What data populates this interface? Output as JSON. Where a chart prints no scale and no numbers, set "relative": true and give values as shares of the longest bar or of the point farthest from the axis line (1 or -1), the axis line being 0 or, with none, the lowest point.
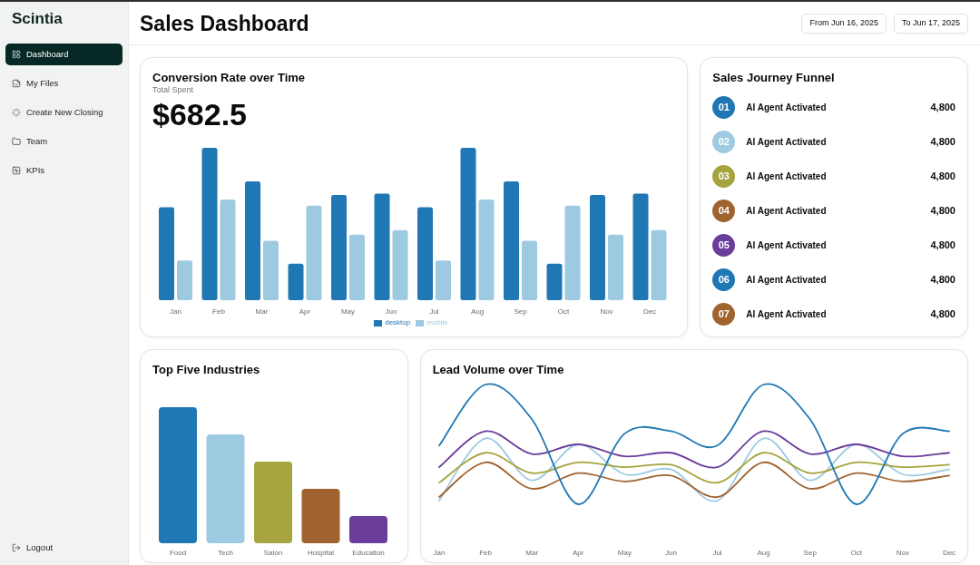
{
  "sidebar": {
    "brand": "Scintia",
    "items": [
      {
        "label": "Dashboard",
        "selected": true
      },
      {
        "label": "My Files",
        "selected": false
      },
      {
        "label": "Create New Closing",
        "selected": false
      },
      {
        "label": "Team",
        "selected": false
      },
      {
        "label": "KPIs",
        "selected": false
      }
    ],
    "footer": {
      "label": "Logout"
    }
  },
  "header": {
    "title": "Sales Dashboard",
    "date_range": [
      "From Jun 16, 2025",
      "To Jun 17, 2025"
    ]
  },
  "conversion_card": {
    "title": "Conversion Rate over Time",
    "subtitle": "Total Spent",
    "amount": "$682.5",
    "chart_data": {
      "type": "bar",
      "relative": true,
      "legend": "bottom",
      "categories": [
        "Jan",
        "Feb",
        "Mar",
        "Apr",
        "May",
        "Jun",
        "Jul",
        "Aug",
        "Sep",
        "Oct",
        "Nov",
        "Dec"
      ],
      "series": [
        {
          "name": "desktop",
          "color": "#1f77b4",
          "values": [
            0.61,
            1,
            0.78,
            0.24,
            0.69,
            0.7,
            0.61,
            1,
            0.78,
            0.24,
            0.69,
            0.7
          ]
        },
        {
          "name": "mobile",
          "color": "#9ecae1",
          "values": [
            0.26,
            0.66,
            0.39,
            0.62,
            0.43,
            0.46,
            0.26,
            0.66,
            0.39,
            0.62,
            0.43,
            0.46
          ]
        }
      ]
    }
  },
  "funnel": {
    "title": "Sales Journey Funnel",
    "items": [
      {
        "number": "01",
        "label": "AI Agent Activated",
        "value": "4,800",
        "color": "#1f77b4"
      },
      {
        "number": "02",
        "label": "AI Agent Activated",
        "value": "4,800",
        "color": "#9ecae1"
      },
      {
        "number": "03",
        "label": "AI Agent Activated",
        "value": "4,800",
        "color": "#a5a43f"
      },
      {
        "number": "04",
        "label": "AI Agent Activated",
        "value": "4,800",
        "color": "#a0632f"
      },
      {
        "number": "05",
        "label": "AI Agent Activated",
        "value": "4,800",
        "color": "#6a3d9a"
      },
      {
        "number": "06",
        "label": "AI Agent Activated",
        "value": "4,800",
        "color": "#1f77b4"
      },
      {
        "number": "07",
        "label": "AI Agent Activated",
        "value": "4,800",
        "color": "#a0632f"
      }
    ]
  },
  "industries_card": {
    "title": "Top Five Industries",
    "chart_data": {
      "type": "bar",
      "relative": true,
      "categories": [
        "Food",
        "Tech",
        "Salon",
        "Hospital",
        "Education"
      ],
      "values": [
        1,
        0.8,
        0.6,
        0.4,
        0.2
      ],
      "colors": [
        "#1f77b4",
        "#9ecae1",
        "#a5a43f",
        "#a0632f",
        "#6a3d9a"
      ]
    }
  },
  "lead_card": {
    "title": "Lead Volume over Time",
    "chart_data": {
      "type": "line",
      "relative": true,
      "categories": [
        "Jan",
        "Feb",
        "Mar",
        "Apr",
        "May",
        "Jun",
        "Jul",
        "Aug",
        "Sep",
        "Oct",
        "Nov",
        "Dec"
      ],
      "series": [
        {
          "color": "#9ecae1",
          "values": [
            0.03,
            0.55,
            0.2,
            0.5,
            0.25,
            0.29,
            0.03,
            0.55,
            0.2,
            0.5,
            0.25,
            0.29
          ]
        },
        {
          "color": "#a0632f",
          "values": [
            0.06,
            0.35,
            0.13,
            0.26,
            0.19,
            0.24,
            0.06,
            0.35,
            0.13,
            0.26,
            0.19,
            0.24
          ]
        },
        {
          "color": "#a5a43f",
          "values": [
            0.18,
            0.43,
            0.26,
            0.35,
            0.31,
            0.33,
            0.18,
            0.43,
            0.26,
            0.35,
            0.31,
            0.33
          ]
        },
        {
          "color": "#6a3d9a",
          "values": [
            0.31,
            0.61,
            0.42,
            0.5,
            0.4,
            0.43,
            0.31,
            0.61,
            0.42,
            0.5,
            0.4,
            0.43
          ]
        },
        {
          "color": "#1f77b4",
          "values": [
            0.49,
            1,
            0.71,
            0,
            0.59,
            0.61,
            0.49,
            1,
            0.71,
            0,
            0.59,
            0.61
          ]
        }
      ]
    }
  }
}
